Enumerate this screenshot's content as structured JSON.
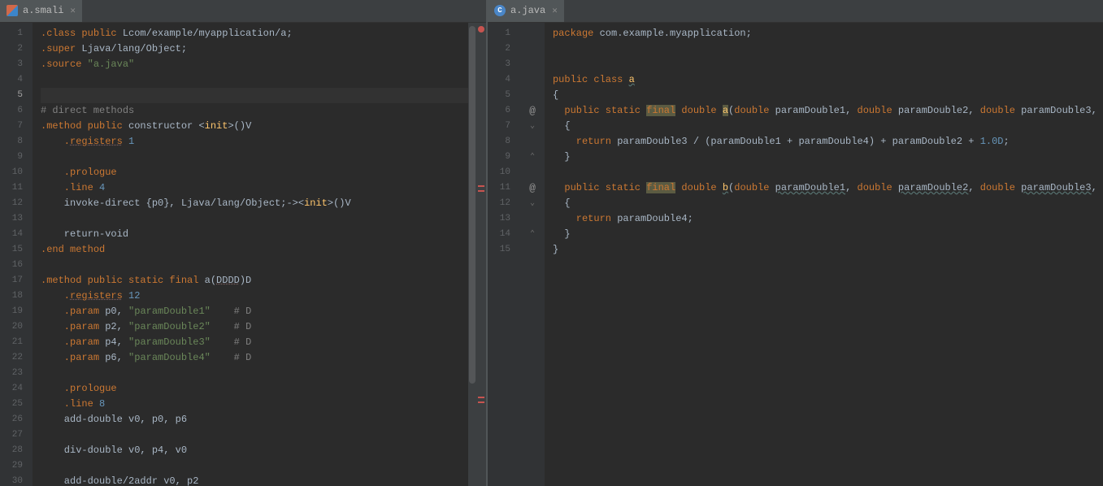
{
  "leftTab": {
    "label": "a.smali",
    "iconLetter": ""
  },
  "rightTab": {
    "label": "a.java",
    "iconLetter": "C"
  },
  "leftCurrentLine": 5,
  "leftLines": [
    {
      "n": 1,
      "tokens": [
        [
          ".",
          "dot"
        ],
        [
          "class public",
          "kw"
        ],
        [
          " Lcom/example/myapplication/a;",
          "def"
        ]
      ]
    },
    {
      "n": 2,
      "tokens": [
        [
          ".",
          "dot"
        ],
        [
          "super",
          "kw"
        ],
        [
          " Ljava/lang/Object;",
          "def"
        ]
      ]
    },
    {
      "n": 3,
      "tokens": [
        [
          ".",
          "dot"
        ],
        [
          "source",
          "kw"
        ],
        [
          " ",
          "op"
        ],
        [
          "\"a.java\"",
          "str"
        ]
      ]
    },
    {
      "n": 4,
      "tokens": []
    },
    {
      "n": 5,
      "tokens": []
    },
    {
      "n": 6,
      "tokens": [
        [
          "# direct methods",
          "cmt"
        ]
      ]
    },
    {
      "n": 7,
      "tokens": [
        [
          ".",
          "dot"
        ],
        [
          "method public",
          "kw"
        ],
        [
          " constructor ",
          "def"
        ],
        [
          "<",
          "op"
        ],
        [
          "init",
          "fn"
        ],
        [
          ">",
          "op"
        ],
        [
          "()V",
          "def"
        ]
      ]
    },
    {
      "n": 8,
      "tokens": [
        [
          "    .",
          "dot"
        ],
        [
          "registers",
          "kw under"
        ],
        [
          " ",
          "op"
        ],
        [
          "1",
          "num"
        ]
      ]
    },
    {
      "n": 9,
      "tokens": []
    },
    {
      "n": 10,
      "tokens": [
        [
          "    .",
          "dot"
        ],
        [
          "prologue",
          "kw"
        ]
      ]
    },
    {
      "n": 11,
      "tokens": [
        [
          "    .",
          "dot"
        ],
        [
          "line",
          "kw"
        ],
        [
          " ",
          "op"
        ],
        [
          "4",
          "num"
        ]
      ]
    },
    {
      "n": 12,
      "tokens": [
        [
          "    invoke-direct {p0}, Ljava/lang/Object;->",
          "def"
        ],
        [
          "<",
          "op"
        ],
        [
          "init",
          "fn"
        ],
        [
          ">",
          "op"
        ],
        [
          "()V",
          "def"
        ]
      ]
    },
    {
      "n": 13,
      "tokens": []
    },
    {
      "n": 14,
      "tokens": [
        [
          "    return-void",
          "def"
        ]
      ]
    },
    {
      "n": 15,
      "tokens": [
        [
          ".",
          "dot"
        ],
        [
          "end method",
          "kw"
        ]
      ]
    },
    {
      "n": 16,
      "tokens": []
    },
    {
      "n": 17,
      "tokens": [
        [
          ".",
          "dot"
        ],
        [
          "method public static final",
          "kw"
        ],
        [
          " a(",
          "def"
        ],
        [
          "DDDD",
          "def under"
        ],
        [
          ")D",
          "def"
        ]
      ]
    },
    {
      "n": 18,
      "tokens": [
        [
          "    .",
          "dot"
        ],
        [
          "registers",
          "kw under"
        ],
        [
          " ",
          "op"
        ],
        [
          "12",
          "num"
        ]
      ]
    },
    {
      "n": 19,
      "tokens": [
        [
          "    .",
          "dot"
        ],
        [
          "param",
          "kw"
        ],
        [
          " p0, ",
          "def"
        ],
        [
          "\"paramDouble1\"",
          "str"
        ],
        [
          "    # D",
          "cmt"
        ]
      ]
    },
    {
      "n": 20,
      "tokens": [
        [
          "    .",
          "dot"
        ],
        [
          "param",
          "kw"
        ],
        [
          " p2, ",
          "def"
        ],
        [
          "\"paramDouble2\"",
          "str"
        ],
        [
          "    # D",
          "cmt"
        ]
      ]
    },
    {
      "n": 21,
      "tokens": [
        [
          "    .",
          "dot"
        ],
        [
          "param",
          "kw"
        ],
        [
          " p4, ",
          "def"
        ],
        [
          "\"paramDouble3\"",
          "str"
        ],
        [
          "    # D",
          "cmt"
        ]
      ]
    },
    {
      "n": 22,
      "tokens": [
        [
          "    .",
          "dot"
        ],
        [
          "param",
          "kw"
        ],
        [
          " p6, ",
          "def"
        ],
        [
          "\"paramDouble4\"",
          "str"
        ],
        [
          "    # D",
          "cmt"
        ]
      ]
    },
    {
      "n": 23,
      "tokens": []
    },
    {
      "n": 24,
      "tokens": [
        [
          "    .",
          "dot"
        ],
        [
          "prologue",
          "kw"
        ]
      ]
    },
    {
      "n": 25,
      "tokens": [
        [
          "    .",
          "dot"
        ],
        [
          "line",
          "kw"
        ],
        [
          " ",
          "op"
        ],
        [
          "8",
          "num"
        ]
      ]
    },
    {
      "n": 26,
      "tokens": [
        [
          "    add-double v0, p0, p6",
          "def"
        ]
      ]
    },
    {
      "n": 27,
      "tokens": []
    },
    {
      "n": 28,
      "tokens": [
        [
          "    div-double v0, p4, v0",
          "def"
        ]
      ]
    },
    {
      "n": 29,
      "tokens": []
    },
    {
      "n": 30,
      "tokens": [
        [
          "    add-double/2addr v0, p2",
          "def"
        ]
      ]
    }
  ],
  "rightLines": [
    {
      "n": 1,
      "mark": "",
      "tokens": [
        [
          "package",
          "kw"
        ],
        [
          " com.example.myapplication;",
          "def"
        ]
      ]
    },
    {
      "n": 2,
      "mark": "",
      "tokens": []
    },
    {
      "n": 3,
      "mark": "",
      "tokens": []
    },
    {
      "n": 4,
      "mark": "",
      "tokens": [
        [
          "public class ",
          "kw"
        ],
        [
          "a",
          "fn underwavy"
        ]
      ]
    },
    {
      "n": 5,
      "mark": "",
      "tokens": [
        [
          "{",
          "op"
        ]
      ]
    },
    {
      "n": 6,
      "mark": "@",
      "tokens": [
        [
          "  ",
          "op"
        ],
        [
          "public static ",
          "kw"
        ],
        [
          "final",
          "kw hl"
        ],
        [
          " ",
          "op"
        ],
        [
          "double",
          "kw"
        ],
        [
          " ",
          "op"
        ],
        [
          "a",
          "fn hl"
        ],
        [
          "(",
          "op"
        ],
        [
          "double",
          "kw"
        ],
        [
          " paramDouble1, ",
          "def"
        ],
        [
          "double",
          "kw"
        ],
        [
          " paramDouble2, ",
          "def"
        ],
        [
          "double",
          "kw"
        ],
        [
          " paramDouble3, ",
          "def"
        ]
      ]
    },
    {
      "n": 7,
      "mark": "⌄",
      "tokens": [
        [
          "  {",
          "op"
        ]
      ]
    },
    {
      "n": 8,
      "mark": "",
      "tokens": [
        [
          "    ",
          "op"
        ],
        [
          "return",
          "kw"
        ],
        [
          " paramDouble3 / (paramDouble1 + paramDouble4) + paramDouble2 + ",
          "def"
        ],
        [
          "1.0D",
          "num"
        ],
        [
          ";",
          "op"
        ]
      ]
    },
    {
      "n": 9,
      "mark": "⌃",
      "tokens": [
        [
          "  }",
          "op"
        ]
      ]
    },
    {
      "n": 10,
      "mark": "",
      "tokens": []
    },
    {
      "n": 11,
      "mark": "@",
      "tokens": [
        [
          "  ",
          "op"
        ],
        [
          "public static ",
          "kw"
        ],
        [
          "final",
          "kw hl"
        ],
        [
          " ",
          "op"
        ],
        [
          "double",
          "kw"
        ],
        [
          " ",
          "op"
        ],
        [
          "b",
          "fn underwavy"
        ],
        [
          "(",
          "op"
        ],
        [
          "double",
          "kw"
        ],
        [
          " ",
          "op"
        ],
        [
          "paramDouble1",
          "def underwavy"
        ],
        [
          ", ",
          "op"
        ],
        [
          "double",
          "kw"
        ],
        [
          " ",
          "op"
        ],
        [
          "paramDouble2",
          "def underwavy"
        ],
        [
          ", ",
          "op"
        ],
        [
          "double",
          "kw"
        ],
        [
          " ",
          "op"
        ],
        [
          "paramDouble3",
          "def underwavy"
        ],
        [
          ", ",
          "op"
        ]
      ]
    },
    {
      "n": 12,
      "mark": "⌄",
      "tokens": [
        [
          "  {",
          "op"
        ]
      ]
    },
    {
      "n": 13,
      "mark": "",
      "tokens": [
        [
          "    ",
          "op"
        ],
        [
          "return",
          "kw"
        ],
        [
          " paramDouble4;",
          "def"
        ]
      ]
    },
    {
      "n": 14,
      "mark": "⌃",
      "tokens": [
        [
          "  }",
          "op"
        ]
      ]
    },
    {
      "n": 15,
      "mark": "",
      "tokens": [
        [
          "}",
          "op"
        ]
      ]
    }
  ]
}
